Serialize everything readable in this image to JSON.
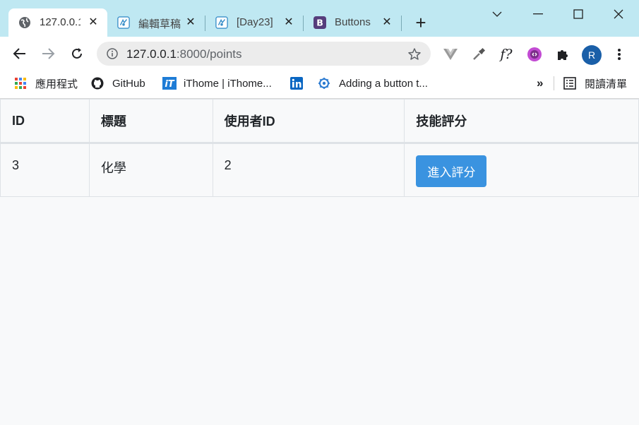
{
  "tabs": [
    {
      "title": "127.0.0.1",
      "icon": "globe-icon",
      "active": true
    },
    {
      "title": "編輯草稿",
      "icon": "ithome-site-icon",
      "active": false
    },
    {
      "title": "[Day23]",
      "icon": "ithome-site-icon",
      "active": false
    },
    {
      "title": "Buttons",
      "icon": "bootstrap-icon",
      "active": false
    }
  ],
  "omnibox": {
    "host": "127.0.0.1",
    "path": ":8000/points"
  },
  "profile_initial": "R",
  "bookmarks": [
    {
      "label": "應用程式",
      "icon": "apps-grid-icon"
    },
    {
      "label": "GitHub",
      "icon": "github-icon"
    },
    {
      "label": "iThome | iThome...",
      "icon": "ithome-icon"
    },
    {
      "label": "",
      "icon": "linkedin-icon"
    },
    {
      "label": "Adding a button t...",
      "icon": "gear-like-site-icon"
    }
  ],
  "bookmarks_overflow": "»",
  "reading_list": "閱讀清單",
  "table": {
    "headers": [
      "ID",
      "標題",
      "使用者ID",
      "技能評分"
    ],
    "rows": [
      {
        "id": "3",
        "title": "化學",
        "user_id": "2",
        "action_label": "進入評分"
      }
    ]
  },
  "colors": {
    "tabstrip": "#bfe8f2",
    "primary_button": "#3a93e0",
    "page_bg": "#f8f9fa"
  }
}
